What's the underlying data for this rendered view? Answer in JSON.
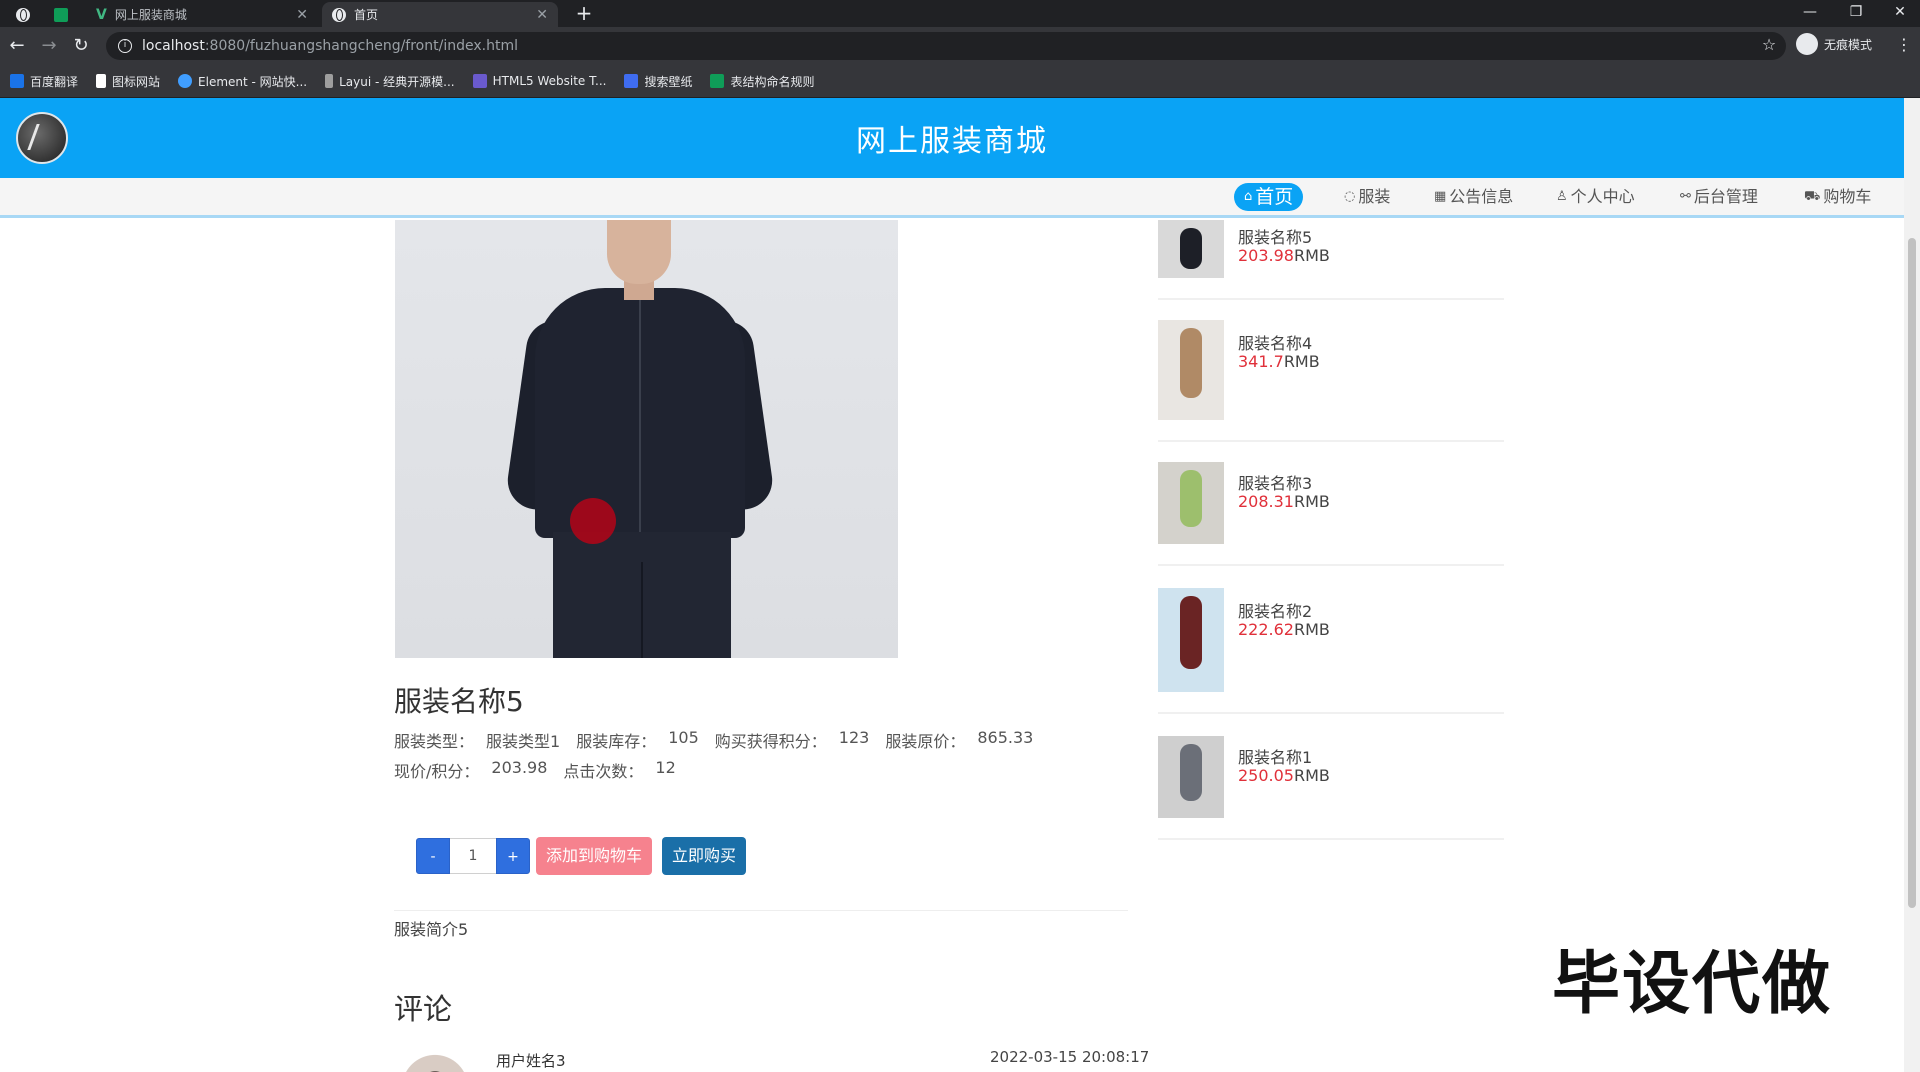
{
  "browser": {
    "tabs": [
      {
        "title": ""
      },
      {
        "title": "网上服装商城"
      },
      {
        "title": "首页"
      }
    ],
    "url_host": "localhost",
    "url_path": ":8080/fuzhuangshangcheng/front/index.html",
    "profile_label": "无痕模式",
    "bookmarks": [
      {
        "label": "百度翻译",
        "color": "#1a73e8"
      },
      {
        "label": "图标网站",
        "color": "#ffffff"
      },
      {
        "label": "Element - 网站快...",
        "color": "#409eff"
      },
      {
        "label": "Layui - 经典开源模...",
        "color": "#9e9e9e"
      },
      {
        "label": "HTML5 Website T...",
        "color": "#6a5acd"
      },
      {
        "label": "搜索壁纸",
        "color": "#3f6cf0"
      },
      {
        "label": "表结构命名规则",
        "color": "#0f9d58"
      }
    ]
  },
  "site": {
    "title": "网上服装商城",
    "nav": [
      {
        "label": "首页",
        "icon": "home-icon",
        "active": true
      },
      {
        "label": "服装",
        "icon": "clothing-icon",
        "active": false
      },
      {
        "label": "公告信息",
        "icon": "announcement-icon",
        "active": false
      },
      {
        "label": "个人中心",
        "icon": "user-icon",
        "active": false
      },
      {
        "label": "后台管理",
        "icon": "link-icon",
        "active": false
      },
      {
        "label": "购物车",
        "icon": "cart-icon",
        "active": false
      }
    ],
    "accent_color": "#0aa3f5"
  },
  "product": {
    "name": "服装名称5",
    "type_label": "服装类型：",
    "type_value": "服装类型1",
    "stock_label": "服装库存：",
    "stock_value": "105",
    "points_label": "购买获得积分：",
    "points_value": "123",
    "orig_price_label": "服装原价：",
    "orig_price_value": "865.33",
    "cur_price_label": "现价/积分：",
    "cur_price_value": "203.98",
    "clicks_label": "点击次数：",
    "clicks_value": "12",
    "qty_minus": "-",
    "qty_value": "1",
    "qty_plus": "+",
    "add_cart_label": "添加到购物车",
    "buy_now_label": "立即购买",
    "description": "服装简介5"
  },
  "comments": {
    "title": "评论",
    "items": [
      {
        "user": "用户姓名3",
        "time": "2022-03-15 20:08:17"
      }
    ]
  },
  "side_list": [
    {
      "name": "服装名称5",
      "price": "203.98",
      "currency": "RMB"
    },
    {
      "name": "服装名称4",
      "price": "341.7",
      "currency": "RMB"
    },
    {
      "name": "服装名称3",
      "price": "208.31",
      "currency": "RMB"
    },
    {
      "name": "服装名称2",
      "price": "222.62",
      "currency": "RMB"
    },
    {
      "name": "服装名称1",
      "price": "250.05",
      "currency": "RMB"
    }
  ],
  "watermark": "毕设代做"
}
